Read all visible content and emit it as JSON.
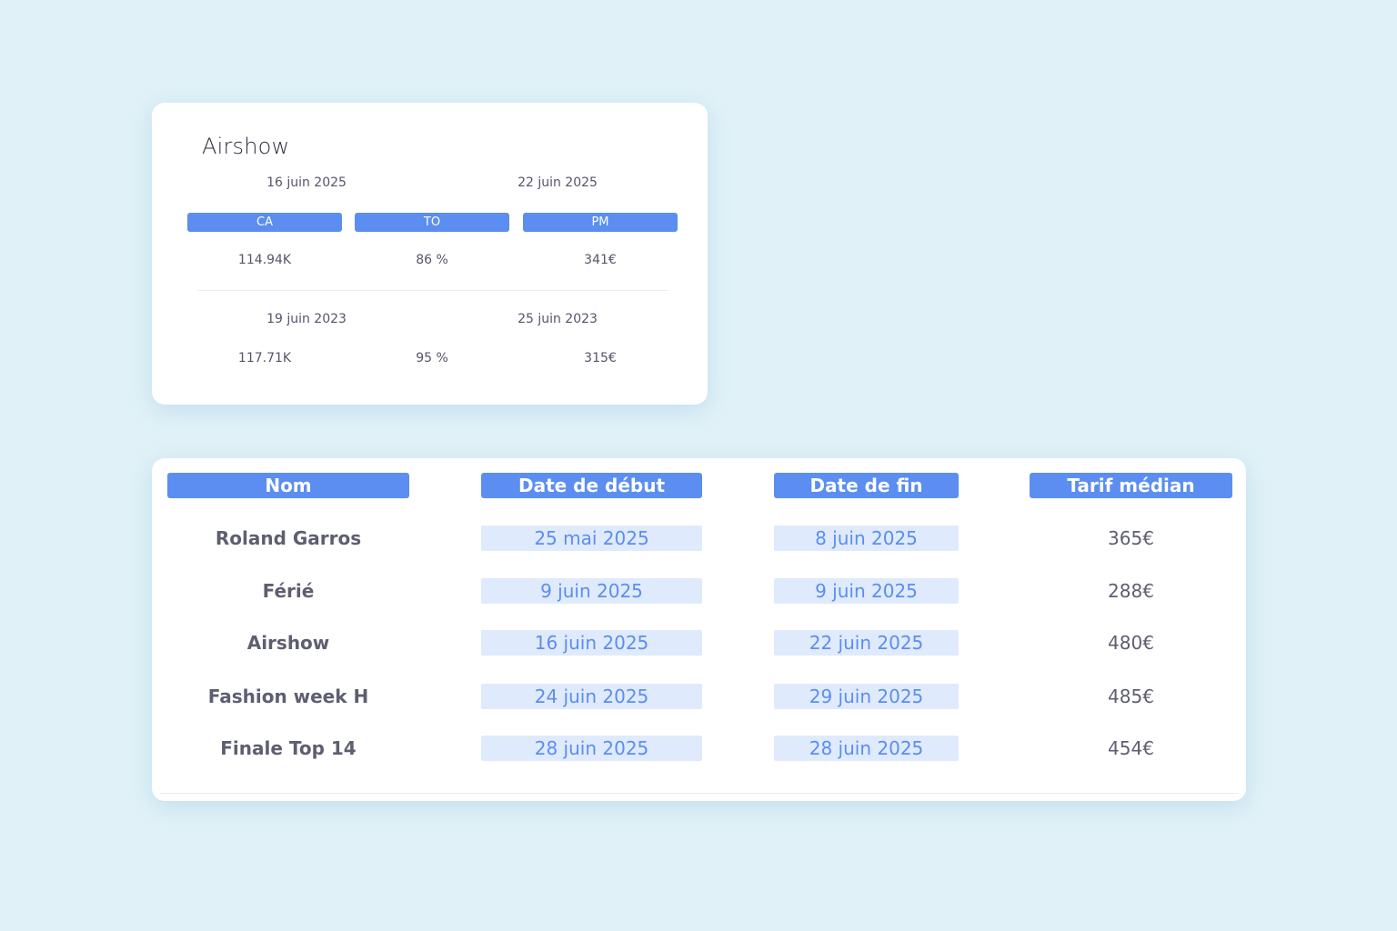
{
  "event_card": {
    "title": "Airshow",
    "current_period": {
      "start_date": "16 juin 2025",
      "end_date": "22 juin 2025",
      "metrics": {
        "ca": "114.94K",
        "to": "86 %",
        "pm": "341€"
      }
    },
    "previous_period": {
      "start_date": "19 juin 2023",
      "end_date": "25 juin 2023",
      "metrics": {
        "ca": "117.71K",
        "to": "95 %",
        "pm": "315€"
      }
    },
    "metric_labels": {
      "ca": "CA",
      "to": "TO",
      "pm": "PM"
    },
    "accent_color": "#5b8ef0"
  },
  "events_table": {
    "headers": {
      "name": "Nom",
      "start_date": "Date de début",
      "end_date": "Date de fin",
      "median_rate": "Tarif médian"
    },
    "rows": [
      {
        "name": "Roland Garros",
        "start_date": "25 mai 2025",
        "end_date": "8 juin 2025",
        "median_rate": "365€"
      },
      {
        "name": "Férié",
        "start_date": "9 juin 2025",
        "end_date": "9 juin 2025",
        "median_rate": "288€"
      },
      {
        "name": "Airshow",
        "start_date": "16 juin 2025",
        "end_date": "22 juin 2025",
        "median_rate": "480€"
      },
      {
        "name": "Fashion week H",
        "start_date": "24 juin 2025",
        "end_date": "29 juin 2025",
        "median_rate": "485€"
      },
      {
        "name": "Finale Top 14",
        "start_date": "28 juin 2025",
        "end_date": "28 juin 2025",
        "median_rate": "454€"
      }
    ],
    "header_color": "#5b8ef0",
    "date_cell_color": "#dfeafd"
  }
}
